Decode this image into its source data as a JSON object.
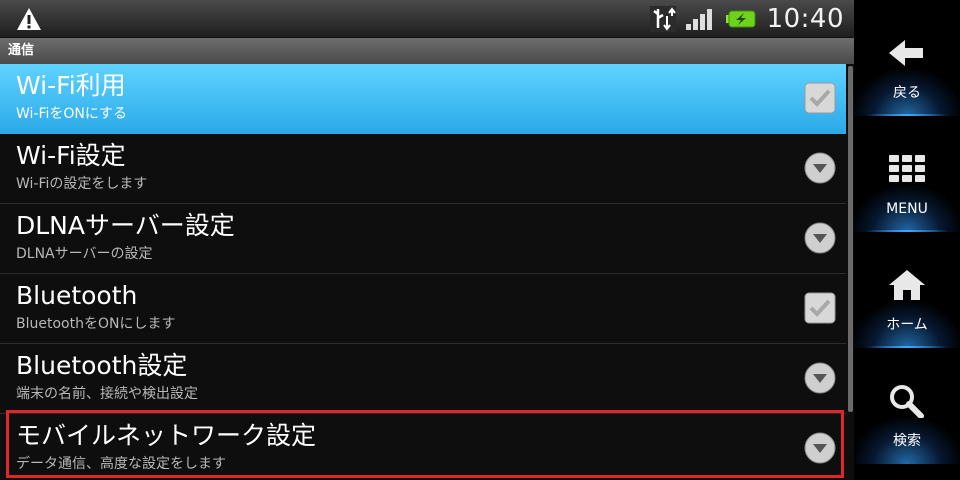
{
  "status_bar": {
    "time": "10:40",
    "icons": [
      "warning-icon",
      "usb-icon",
      "signal-icon",
      "battery-charging-icon"
    ]
  },
  "section": {
    "title": "通信"
  },
  "settings": [
    {
      "title": "Wi-Fi利用",
      "subtitle": "Wi-FiをONにする",
      "control": "checkbox",
      "highlighted": true
    },
    {
      "title": "Wi-Fi設定",
      "subtitle": "Wi-Fiの設定をします",
      "control": "chevron"
    },
    {
      "title": "DLNAサーバー設定",
      "subtitle": "DLNAサーバーの設定",
      "control": "chevron"
    },
    {
      "title": "Bluetooth",
      "subtitle": "BluetoothをONにします",
      "control": "checkbox"
    },
    {
      "title": "Bluetooth設定",
      "subtitle": "端末の名前、接続や検出設定",
      "control": "chevron"
    },
    {
      "title": "モバイルネットワーク設定",
      "subtitle": "データ通信、高度な設定をします",
      "control": "chevron",
      "outlined": true
    }
  ],
  "nav": {
    "back_label": "戻る",
    "menu_label": "MENU",
    "home_label": "ホーム",
    "search_label": "検索"
  },
  "colors": {
    "highlight": "#3cb8f0",
    "outline": "#e0252b",
    "accent_glow": "#2d8cdc"
  }
}
